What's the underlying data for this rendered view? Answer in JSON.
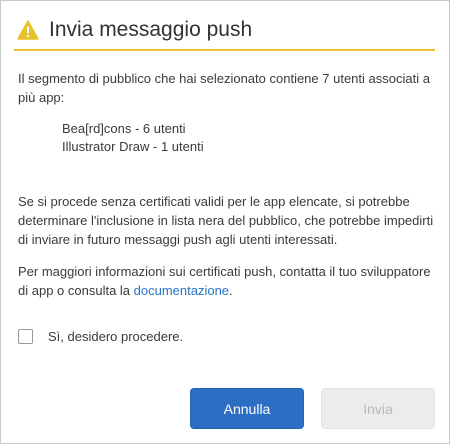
{
  "dialog": {
    "title": "Invia messaggio push",
    "intro": "Il segmento di pubblico che hai selezionato contiene 7 utenti associati a più app:",
    "apps": [
      "Bea[rd]cons - 6 utenti",
      "Illustrator Draw - 1 utenti"
    ],
    "warning": "Se si procede senza certificati validi per le app elencate, si potrebbe determinare l'inclusione in lista nera del pubblico, che potrebbe impedirti di inviare in futuro messaggi push agli utenti interessati.",
    "info_prefix": "Per maggiori informazioni sui certificati push, contatta il tuo sviluppatore di app o consulta la ",
    "info_link": "documentazione",
    "info_suffix": ".",
    "confirm_label": "Sì, desidero procedere.",
    "cancel_label": "Annulla",
    "send_label": "Invia",
    "confirm_checked": false,
    "send_enabled": false
  },
  "colors": {
    "accent_warning": "#e8c22a",
    "primary_button": "#2b6ec4",
    "link": "#2a74c7"
  },
  "icons": {
    "header": "warning-triangle-icon"
  }
}
